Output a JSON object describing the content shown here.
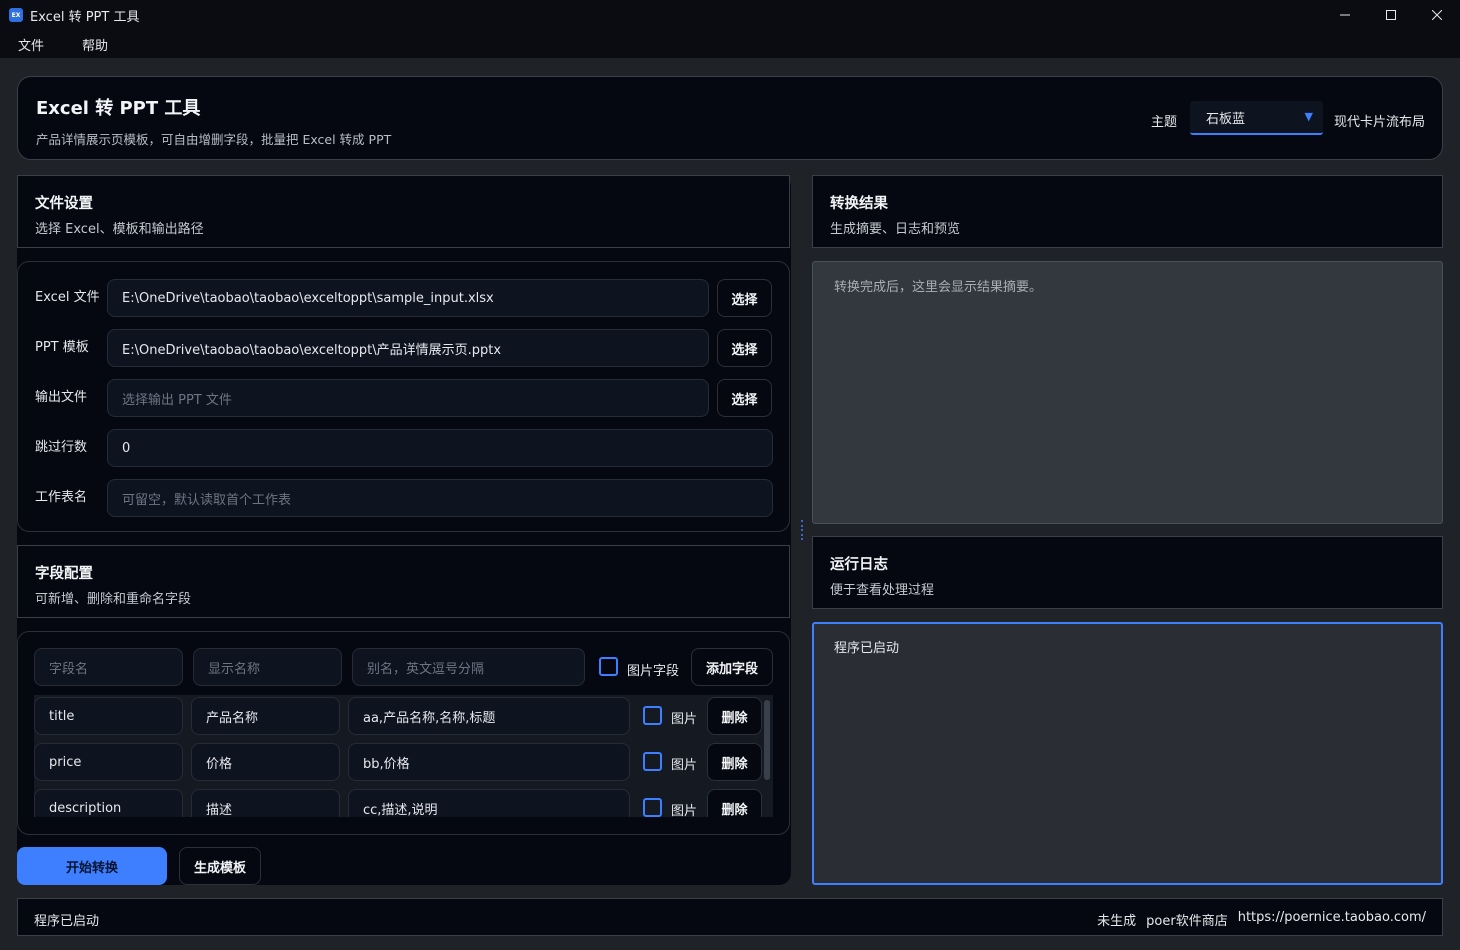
{
  "window": {
    "icon_text": "EX",
    "title": "Excel 转 PPT 工具"
  },
  "menu": [
    "文件",
    "帮助"
  ],
  "header": {
    "title": "Excel 转 PPT 工具",
    "subtitle": "产品详情展示页模板，可自由增删字段，批量把 Excel 转成 PPT",
    "theme_label": "主题",
    "theme_value": "石板蓝",
    "layout_label": "现代卡片流布局"
  },
  "file_settings": {
    "title": "文件设置",
    "subtitle": "选择 Excel、模板和输出路径",
    "excel_label": "Excel 文件",
    "excel_value": "E:\\OneDrive\\taobao\\taobao\\exceltoppt\\sample_input.xlsx",
    "template_label": "PPT 模板",
    "template_value": "E:\\OneDrive\\taobao\\taobao\\exceltoppt\\产品详情展示页.pptx",
    "output_label": "输出文件",
    "output_placeholder": "选择输出 PPT 文件",
    "skip_label": "跳过行数",
    "skip_value": "0",
    "sheet_label": "工作表名",
    "sheet_placeholder": "可留空，默认读取首个工作表",
    "pick_label": "选择"
  },
  "field_config": {
    "title": "字段配置",
    "subtitle": "可新增、删除和重命名字段",
    "new_field_placeholder": "字段名",
    "new_display_placeholder": "显示名称",
    "new_alias_placeholder": "别名，英文逗号分隔",
    "image_field_label": "图片字段",
    "add_label": "添加字段",
    "rows": [
      {
        "name": "title",
        "display": "产品名称",
        "aliases": "aa,产品名称,名称,标题",
        "image_label": "图片",
        "delete_label": "删除"
      },
      {
        "name": "price",
        "display": "价格",
        "aliases": "bb,价格",
        "image_label": "图片",
        "delete_label": "删除"
      },
      {
        "name": "description",
        "display": "描述",
        "aliases": "cc,描述,说明",
        "image_label": "图片",
        "delete_label": "删除"
      }
    ]
  },
  "actions": {
    "start_label": "开始转换",
    "generate_label": "生成模板"
  },
  "result": {
    "title": "转换结果",
    "subtitle": "生成摘要、日志和预览",
    "placeholder": "转换完成后，这里会显示结果摘要。"
  },
  "log": {
    "title": "运行日志",
    "subtitle": "便于查看处理过程",
    "text": "程序已启动"
  },
  "status": {
    "left": "程序已启动",
    "state": "未生成",
    "store": "poer软件商店",
    "url": "https://poernice.taobao.com/"
  },
  "colors": {
    "accent": "#3d7fff",
    "panel": "#050810",
    "background": "#1f2226"
  }
}
